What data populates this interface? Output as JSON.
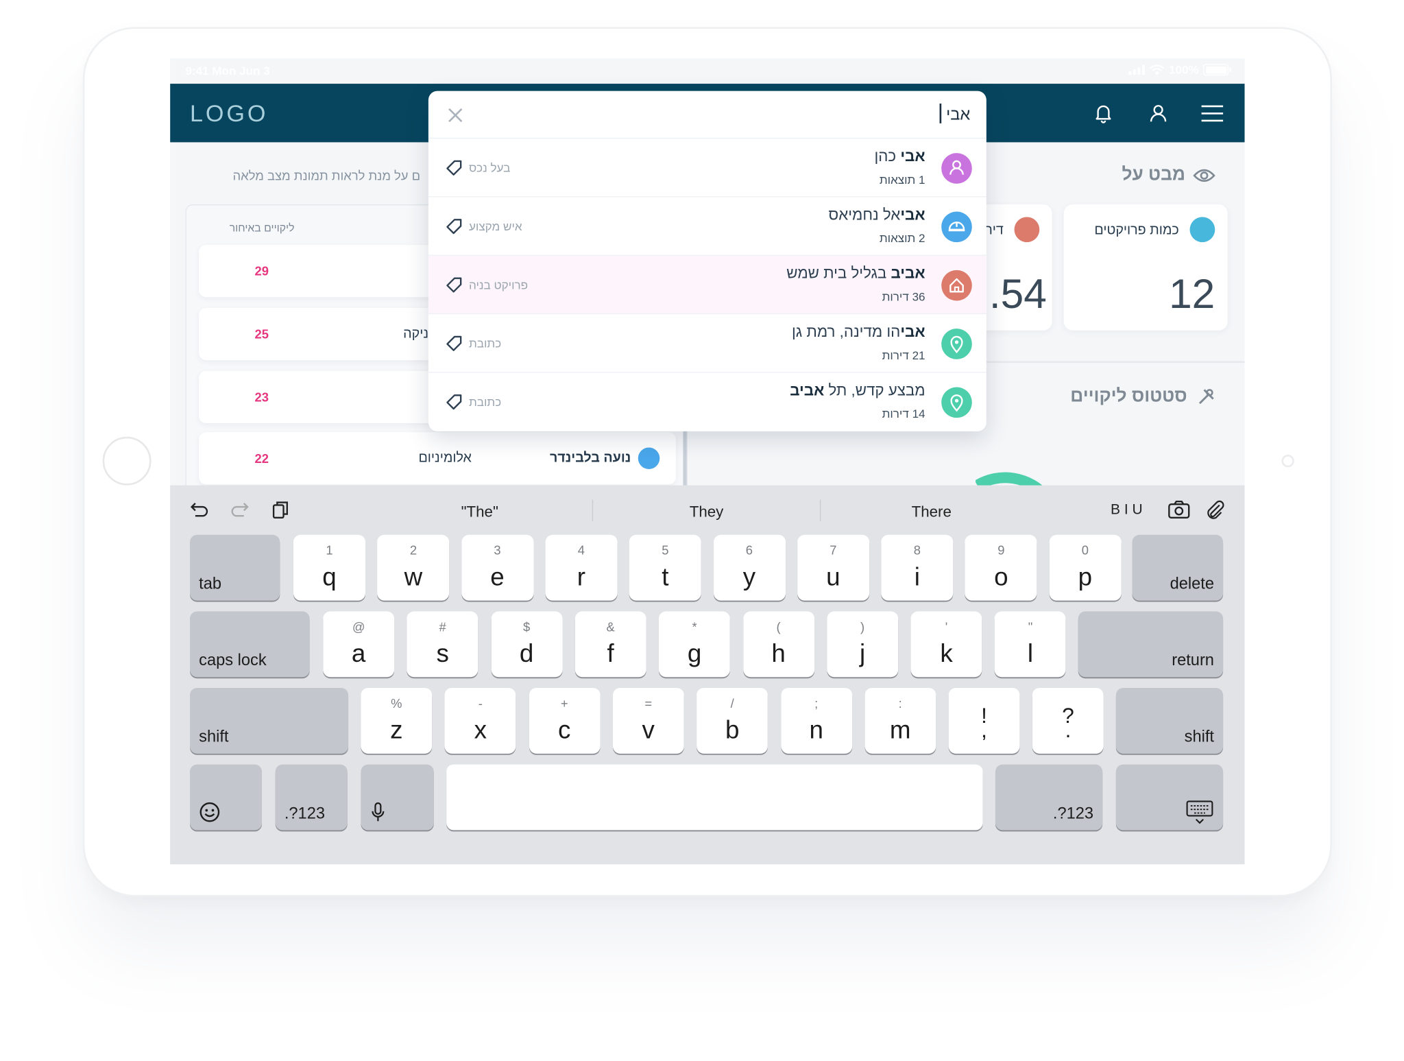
{
  "status_bar": {
    "time": "9:41  Mon Jun 3",
    "battery": "100%"
  },
  "app_bar": {
    "logo": "LOGO"
  },
  "background": {
    "hint_text": "ם על מנת לראות תמונת מצב מלאה",
    "table_header": "ליקויים באיחור",
    "rows": [
      {
        "count": "29",
        "category": "",
        "name": ""
      },
      {
        "count": "25",
        "category": "ניקה",
        "name": ""
      },
      {
        "count": "23",
        "category": "",
        "name": ""
      },
      {
        "count": "22",
        "category": "אלומיניום",
        "name": "נועה בלבינדר"
      }
    ],
    "overview_title": "מבט על",
    "stats": [
      {
        "label": "כמות פרויקטים",
        "value": "12",
        "color": "#48b7dc"
      },
      {
        "label": "דירו",
        "value": ".54",
        "color": "#dc7b6b"
      }
    ],
    "status_title": "סטטוס ליקויים"
  },
  "search": {
    "query": "אבי",
    "results": [
      {
        "bold": "אבי",
        "rest": " כהן",
        "sub": "1 תוצאות",
        "tag": "בעל נכס",
        "avatar_color": "#c973de",
        "icon": "user-icon"
      },
      {
        "bold": "אבי",
        "rest": "אל נחמיאס",
        "sub": "2 תוצאות",
        "tag": "איש מקצוע",
        "avatar_color": "#4aa7ea",
        "icon": "helmet-icon"
      },
      {
        "bold": "אביב",
        "rest": " בגליל בית שמש",
        "sub": "36 דירות",
        "tag": "פרויקט בניה",
        "avatar_color": "#dc7b6b",
        "icon": "home-icon",
        "highlighted": true
      },
      {
        "bold": "אבי",
        "rest": "הו מדינה, רמת גן",
        "sub": "21 דירות",
        "tag": "כתובת",
        "avatar_color": "#4ccfaa",
        "icon": "location-pin-icon"
      },
      {
        "bold": "",
        "rest": "מבצע קדש, תל ",
        "bold2": "אביב",
        "sub": "14 דירות",
        "tag": "כתובת",
        "avatar_color": "#4ccfaa",
        "icon": "location-pin-icon"
      }
    ]
  },
  "keyboard": {
    "suggestions": [
      "\"The\"",
      "They",
      "There"
    ],
    "format": "B I U",
    "row1": [
      [
        "1",
        "q"
      ],
      [
        "2",
        "w"
      ],
      [
        "3",
        "e"
      ],
      [
        "4",
        "r"
      ],
      [
        "5",
        "t"
      ],
      [
        "6",
        "y"
      ],
      [
        "7",
        "u"
      ],
      [
        "8",
        "i"
      ],
      [
        "9",
        "o"
      ],
      [
        "0",
        "p"
      ]
    ],
    "row2": [
      [
        "@",
        "a"
      ],
      [
        "#",
        "s"
      ],
      [
        "$",
        "d"
      ],
      [
        "&",
        "f"
      ],
      [
        "*",
        "g"
      ],
      [
        "(",
        "h"
      ],
      [
        ")",
        "j"
      ],
      [
        "'",
        "k"
      ],
      [
        "\"",
        "l"
      ]
    ],
    "row3": [
      [
        "%",
        "z"
      ],
      [
        "-",
        "x"
      ],
      [
        "+",
        "c"
      ],
      [
        "=",
        "v"
      ],
      [
        "/",
        "b"
      ],
      [
        ";",
        "n"
      ],
      [
        ":",
        "m"
      ]
    ],
    "row3_punct": [
      [
        "!",
        ","
      ],
      [
        "?",
        "."
      ]
    ],
    "labels": {
      "tab": "tab",
      "delete": "delete",
      "caps": "caps lock",
      "return": "return",
      "shift": "shift",
      "numbers": ".?123"
    }
  }
}
